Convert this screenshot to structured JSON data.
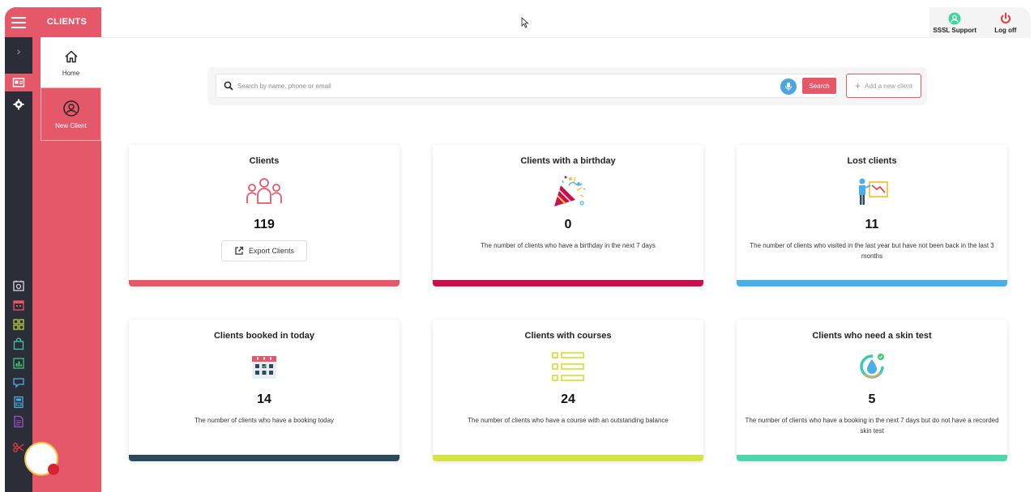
{
  "sidebar": {
    "section_title": "CLIENTS",
    "items": [
      {
        "label": "Home"
      },
      {
        "label": "New Client"
      }
    ]
  },
  "topbar": {
    "support_label": "SSSL Support",
    "logoff_label": "Log off"
  },
  "search": {
    "placeholder": "Search by name, phone or email",
    "button_label": "Search",
    "add_label": "Add a new client"
  },
  "cards": [
    {
      "title": "Clients",
      "value": "119",
      "button_label": "Export Clients",
      "color": "#e5586a"
    },
    {
      "title": "Clients with a birthday",
      "value": "0",
      "description": "The number of clients who have a birthday in the next 7 days",
      "color": "#c8104f"
    },
    {
      "title": "Lost clients",
      "value": "11",
      "description": "The number of clients who visited in the last year but have not been back in the last 3 months",
      "color": "#4aaee8"
    },
    {
      "title": "Clients booked in today",
      "value": "14",
      "description": "The number of clients who have a booking today",
      "color": "#2c4a5e"
    },
    {
      "title": "Clients with courses",
      "value": "24",
      "description": "The number of clients who have a course with an outstanding balance",
      "color": "#d4e445"
    },
    {
      "title": "Clients who need a skin test",
      "value": "5",
      "description": "The number of clients who have a booking in the next 7 days but do not have a recorded skin test",
      "color": "#4fd6b0"
    }
  ],
  "colors": {
    "accent": "#e5586a",
    "rail": "#2b2d38"
  }
}
